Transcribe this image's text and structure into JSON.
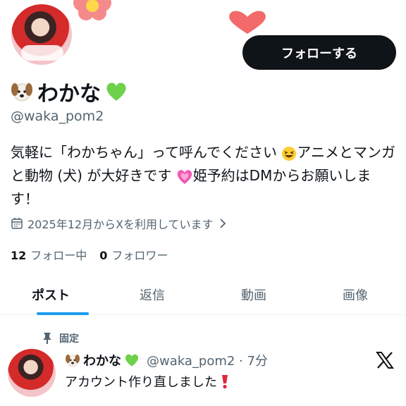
{
  "header": {
    "follow_label": "フォローする"
  },
  "profile": {
    "display_name": "わかな",
    "handle": "@waka_pom2",
    "bio_line1": "気軽に「わかちゃん」って呼んでください",
    "bio_line1_tail": "アニメとマンガ",
    "bio_line2_head": "と動物 (犬) が大好きです",
    "bio_line2_tail": "姫予約はDMからお願いしま",
    "bio_line3": "す！",
    "joined": "2025年12月からXを利用しています",
    "following_count": "12",
    "following_label": "フォロー中",
    "followers_count": "0",
    "followers_label": "フォロワー"
  },
  "tabs": [
    {
      "label": "ポスト"
    },
    {
      "label": "返信"
    },
    {
      "label": "動画"
    },
    {
      "label": "画像"
    }
  ],
  "post": {
    "pinned_label": "固定",
    "author_name": "わかな",
    "meta": "@waka_pom2 · 7分",
    "text": "アカウント作り直しました"
  },
  "colors": {
    "accent": "#1d9bf0",
    "text_primary": "#0f1419",
    "text_secondary": "#536471",
    "button_bg": "#0f1419"
  },
  "icons": [
    "dog-emoji-icon",
    "green-heart-icon",
    "laughing-emoji-icon",
    "pink-heart-icon",
    "calendar-icon",
    "chevron-right-icon",
    "pin-icon",
    "x-logo-icon",
    "exclamation-icon"
  ]
}
